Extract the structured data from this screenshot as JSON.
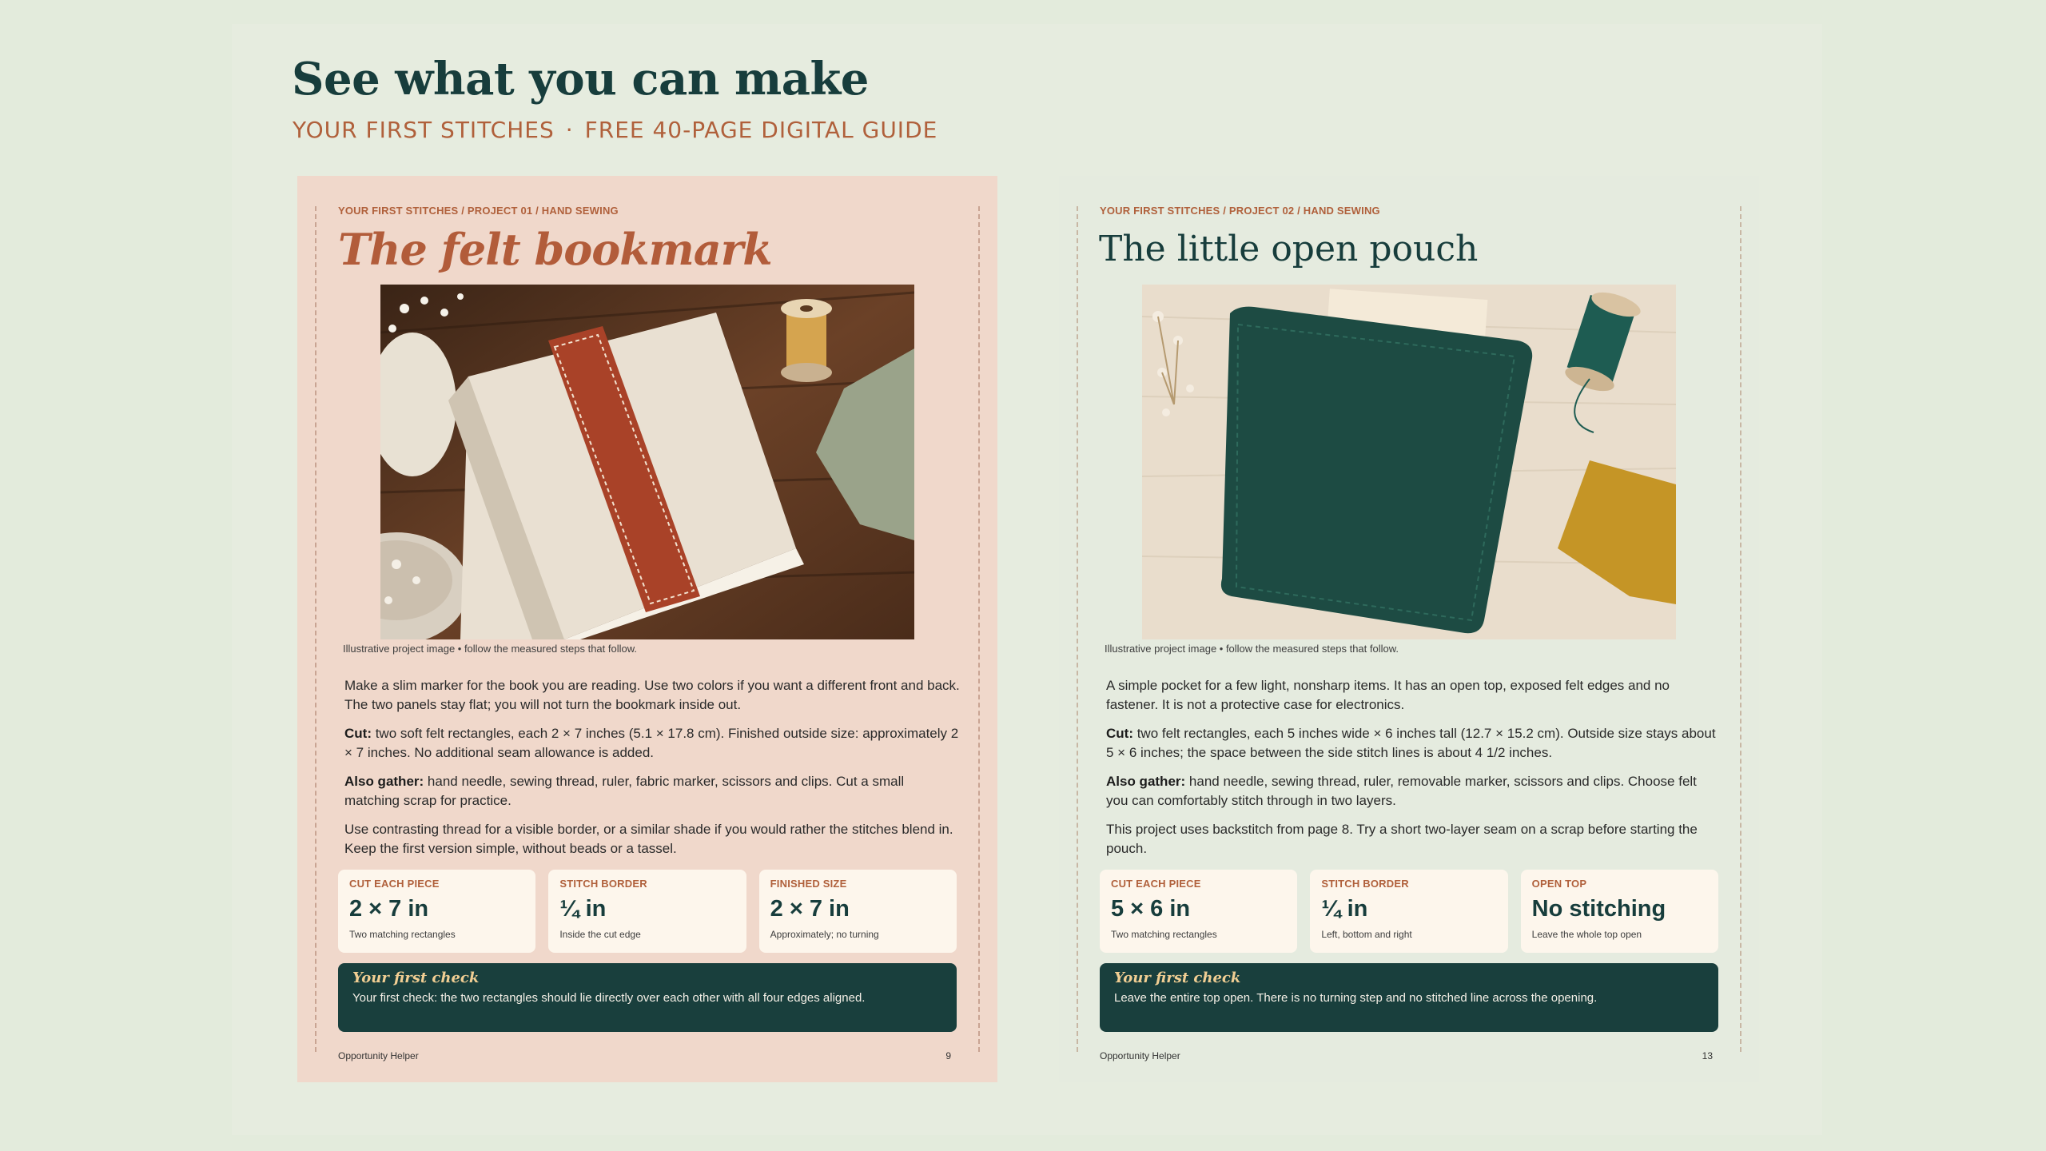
{
  "header": {
    "title": "See what you can make",
    "subtitle_left": "YOUR FIRST STITCHES",
    "subtitle_sep": "·",
    "subtitle_right": "FREE 40-PAGE DIGITAL GUIDE"
  },
  "pages": [
    {
      "breadcrumb": "YOUR FIRST STITCHES  /  PROJECT 01 / HAND SEWING",
      "title": "The felt bookmark",
      "photo_caption": "Illustrative project image • follow the measured steps that follow.",
      "intro": "Make a slim marker for the book you are reading. Use two colors if you want a different front and back. The two panels stay flat; you will not turn the bookmark inside out.",
      "cut_label": "Cut:",
      "cut_text": " two soft felt rectangles, each 2 × 7 inches (5.1 × 17.8 cm). Finished outside size: approximately 2 × 7 inches. No additional seam allowance is added.",
      "gather_label": "Also gather:",
      "gather_text": " hand needle, sewing thread, ruler, fabric marker, scissors and clips. Cut a small matching scrap for practice.",
      "tip": "Use contrasting thread for a visible border, or a similar shade if you would rather the stitches blend in. Keep the first version simple, without beads or a tassel.",
      "stats": [
        {
          "label": "CUT EACH PIECE",
          "value": "2 × 7 in",
          "note": "Two matching rectangles"
        },
        {
          "label": "STITCH BORDER",
          "value": "¼ in",
          "note": "Inside the cut edge"
        },
        {
          "label": "FINISHED SIZE",
          "value": "2 × 7 in",
          "note": "Approximately; no turning"
        }
      ],
      "check_title": "Your first check",
      "check_text": "Your first check: the two rectangles should lie directly over each other with all four edges aligned.",
      "footer_brand": "Opportunity Helper",
      "page_number": "9"
    },
    {
      "breadcrumb": "YOUR FIRST STITCHES  /  PROJECT 02 / HAND SEWING",
      "title": "The little open pouch",
      "photo_caption": "Illustrative project image • follow the measured steps that follow.",
      "intro": "A simple pocket for a few light, nonsharp items. It has an open top, exposed felt edges and no fastener. It is not a protective case for electronics.",
      "cut_label": "Cut:",
      "cut_text": " two felt rectangles, each 5 inches wide × 6 inches tall (12.7 × 15.2 cm). Outside size stays about 5 × 6 inches; the space between the side stitch lines is about 4 1/2 inches.",
      "gather_label": "Also gather:",
      "gather_text": " hand needle, sewing thread, ruler, removable marker, scissors and clips. Choose felt you can comfortably stitch through in two layers.",
      "tip": "This project uses backstitch from page 8. Try a short two-layer seam on a scrap before starting the pouch.",
      "stats": [
        {
          "label": "CUT EACH PIECE",
          "value": "5 × 6 in",
          "note": "Two matching rectangles"
        },
        {
          "label": "STITCH BORDER",
          "value": "¼ in",
          "note": "Left, bottom and right"
        },
        {
          "label": "OPEN TOP",
          "value": "No stitching",
          "note": "Leave the whole top open"
        }
      ],
      "check_title": "Your first check",
      "check_text": "Leave the entire top open. There is no turning step and no stitched line across the opening.",
      "footer_brand": "Opportunity Helper",
      "page_number": "13"
    }
  ]
}
